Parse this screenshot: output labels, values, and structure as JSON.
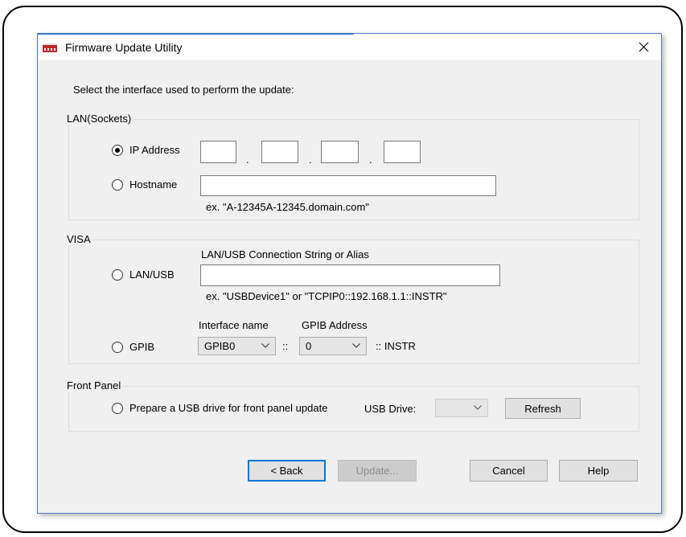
{
  "window": {
    "title": "Firmware Update Utility"
  },
  "instruction": "Select the interface used to perform the update:",
  "lan_sockets": {
    "group_label": "LAN(Sockets)",
    "ip_address_label": "IP Address",
    "ip_address_selected": true,
    "ip_octets": [
      "",
      "",
      "",
      ""
    ],
    "ip_separator": ".",
    "hostname_label": "Hostname",
    "hostname_value": "",
    "hostname_example": "ex. \"A-12345A-12345.domain.com\""
  },
  "visa": {
    "group_label": "VISA",
    "connection_string_label": "LAN/USB Connection String or Alias",
    "lan_usb_label": "LAN/USB",
    "lan_usb_value": "",
    "lan_usb_example": "ex. \"USBDevice1\" or \"TCPIP0::192.168.1.1::INSTR\"",
    "interface_name_label": "Interface name",
    "gpib_address_label": "GPIB Address",
    "gpib_label": "GPIB",
    "interface_name_value": "GPIB0",
    "separator": "::",
    "gpib_address_value": "0",
    "instr_suffix": ":: INSTR"
  },
  "front_panel": {
    "group_label": "Front Panel",
    "prepare_usb_label": "Prepare a USB drive for front panel update",
    "usb_drive_label": "USB Drive:",
    "usb_drive_value": "",
    "refresh_label": "Refresh"
  },
  "buttons": {
    "back": "< Back",
    "update": "Update...",
    "cancel": "Cancel",
    "help": "Help"
  },
  "colors": {
    "accent": "#0078d7",
    "app_icon": "#c4262e",
    "dialog_background": "#f0f0f0"
  }
}
